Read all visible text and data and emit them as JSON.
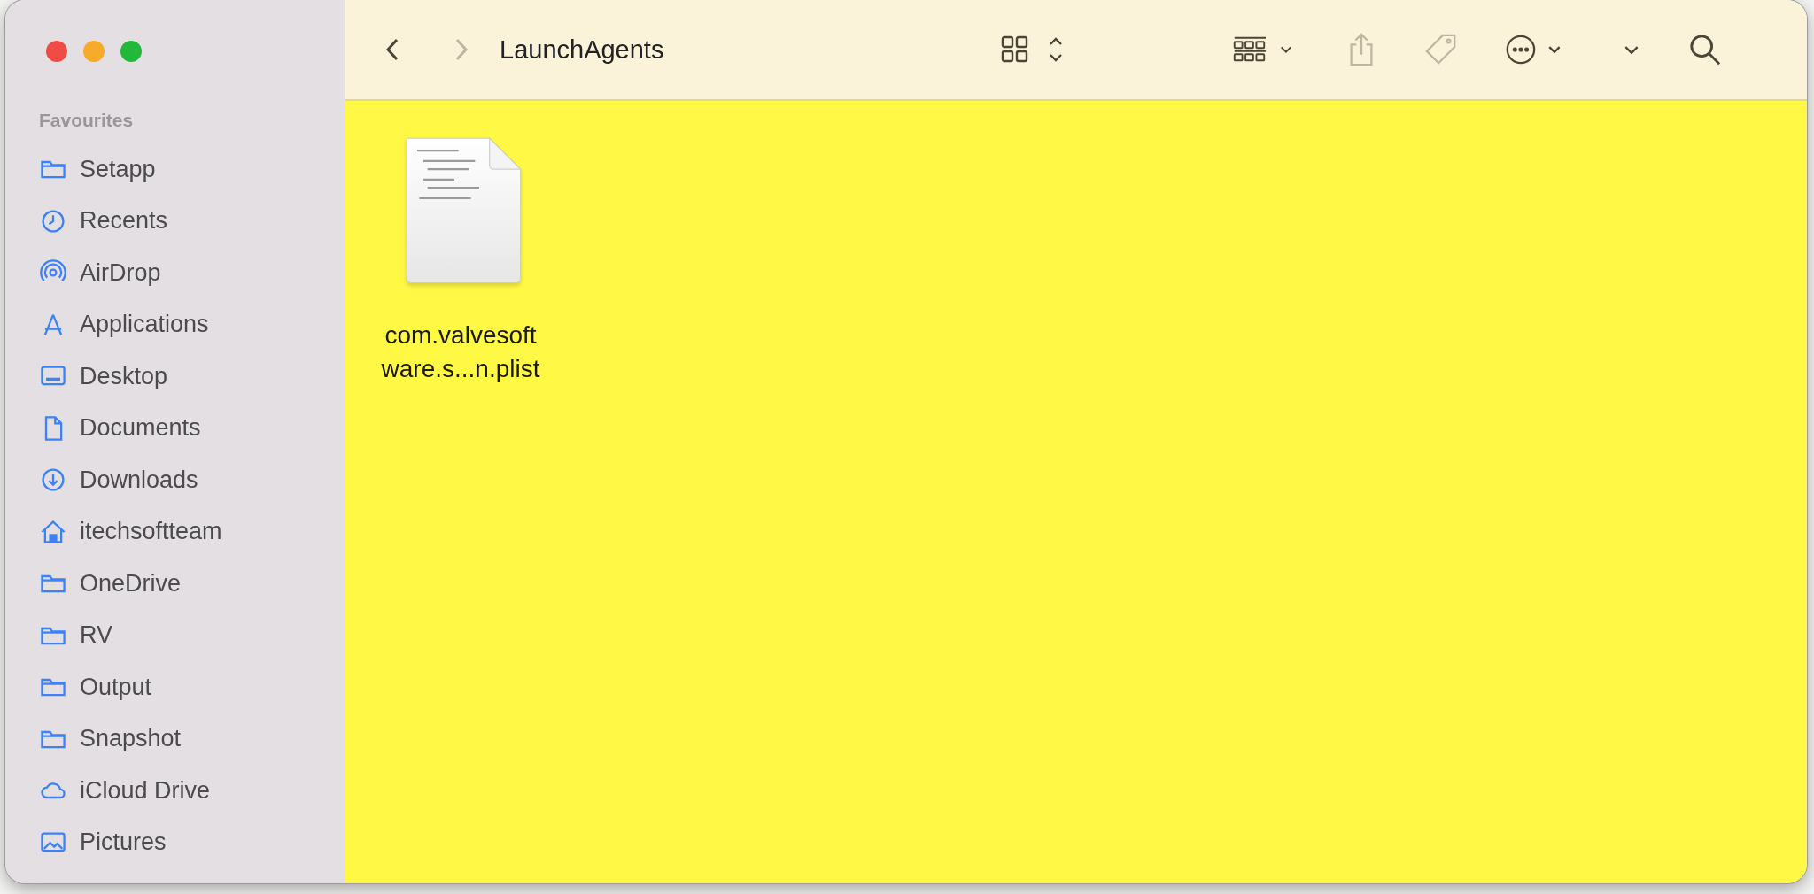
{
  "window": {
    "title": "LaunchAgents"
  },
  "toolbar": {
    "back": {
      "disabled": false
    },
    "forward": {
      "disabled": true
    },
    "buttons": [
      {
        "kind": "view",
        "disabled": false
      },
      {
        "kind": "group",
        "disabled": false
      },
      {
        "kind": "share",
        "disabled": true
      },
      {
        "kind": "tag",
        "disabled": true
      },
      {
        "kind": "more",
        "disabled": false
      },
      {
        "kind": "expand",
        "disabled": false
      },
      {
        "kind": "search",
        "disabled": false
      }
    ]
  },
  "sidebar": {
    "heading": "Favourites",
    "items": [
      {
        "label": "Setapp",
        "kind": "folder",
        "selected": false
      },
      {
        "label": "Recents",
        "kind": "recents",
        "selected": false
      },
      {
        "label": "AirDrop",
        "kind": "airdrop",
        "selected": false
      },
      {
        "label": "Applications",
        "kind": "apps",
        "selected": false
      },
      {
        "label": "Desktop",
        "kind": "desktop",
        "selected": false
      },
      {
        "label": "Documents",
        "kind": "document",
        "selected": false
      },
      {
        "label": "Downloads",
        "kind": "download",
        "selected": false
      },
      {
        "label": "itechsoftteam",
        "kind": "home",
        "selected": false
      },
      {
        "label": "OneDrive",
        "kind": "folder",
        "selected": false
      },
      {
        "label": "RV",
        "kind": "folder",
        "selected": false
      },
      {
        "label": "Output",
        "kind": "folder",
        "selected": false
      },
      {
        "label": "Snapshot",
        "kind": "folder",
        "selected": false
      },
      {
        "label": "iCloud Drive",
        "kind": "cloud",
        "selected": false
      },
      {
        "label": "Pictures",
        "kind": "pictures",
        "selected": false
      }
    ]
  },
  "files": [
    {
      "name_lines": [
        "com.valvesoft",
        "ware.s...n.plist"
      ],
      "selected": false
    }
  ]
}
